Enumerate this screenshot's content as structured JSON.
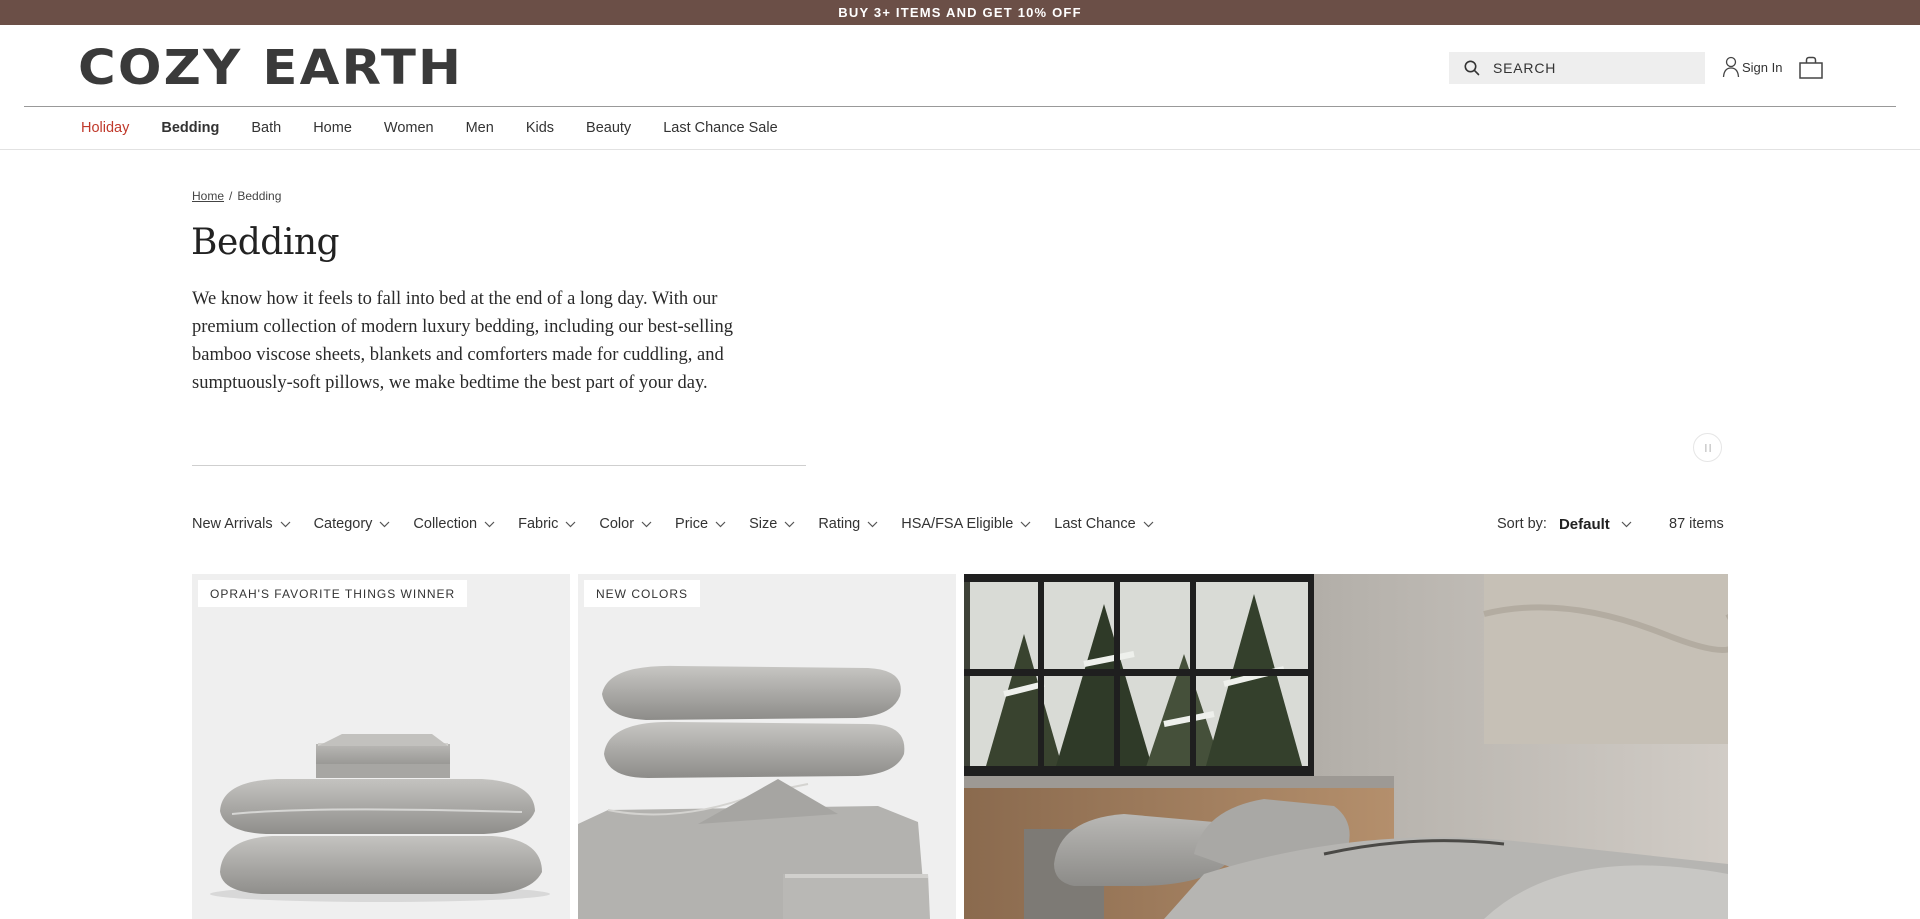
{
  "promo": {
    "text": "BUY 3+ ITEMS AND GET 10% OFF"
  },
  "header": {
    "logo": "COZY EARTH",
    "search_placeholder": "SEARCH",
    "signin_label": "Sign In",
    "icons": {
      "search": "search-icon",
      "user": "user-icon",
      "cart": "shopping-bag-icon"
    }
  },
  "nav": {
    "items": [
      "Holiday",
      "Bedding",
      "Bath",
      "Home",
      "Women",
      "Men",
      "Kids",
      "Beauty",
      "Last Chance Sale"
    ],
    "active": "Bedding",
    "highlight": "Holiday"
  },
  "breadcrumb": {
    "home": "Home",
    "separator": "/",
    "current": "Bedding"
  },
  "page": {
    "title": "Bedding",
    "description": "We know how it feels to fall into bed at the end of a long day. With our premium collection of modern luxury bedding, including our best-selling bamboo viscose sheets, blankets and comforters made for cuddling, and sumptuously-soft pillows, we make bedtime the best part of your day."
  },
  "filters": [
    "New Arrivals",
    "Category",
    "Collection",
    "Fabric",
    "Color",
    "Price",
    "Size",
    "Rating",
    "HSA/FSA Eligible",
    "Last Chance"
  ],
  "sort": {
    "label": "Sort by:",
    "value": "Default"
  },
  "item_count": "87 items",
  "products": [
    {
      "badge": "OPRAH'S FAVORITE THINGS WINNER",
      "image": "folded-sheet-set-image"
    },
    {
      "badge": "NEW COLORS",
      "image": "pillows-and-duvet-image"
    },
    {
      "badge": "",
      "image": "bedroom-lifestyle-image"
    }
  ],
  "colors": {
    "promo_bg": "#6b4f47",
    "holiday": "#c0392b",
    "tile_bg": "#efefef",
    "bedding_gray": "#a9a8a5"
  }
}
